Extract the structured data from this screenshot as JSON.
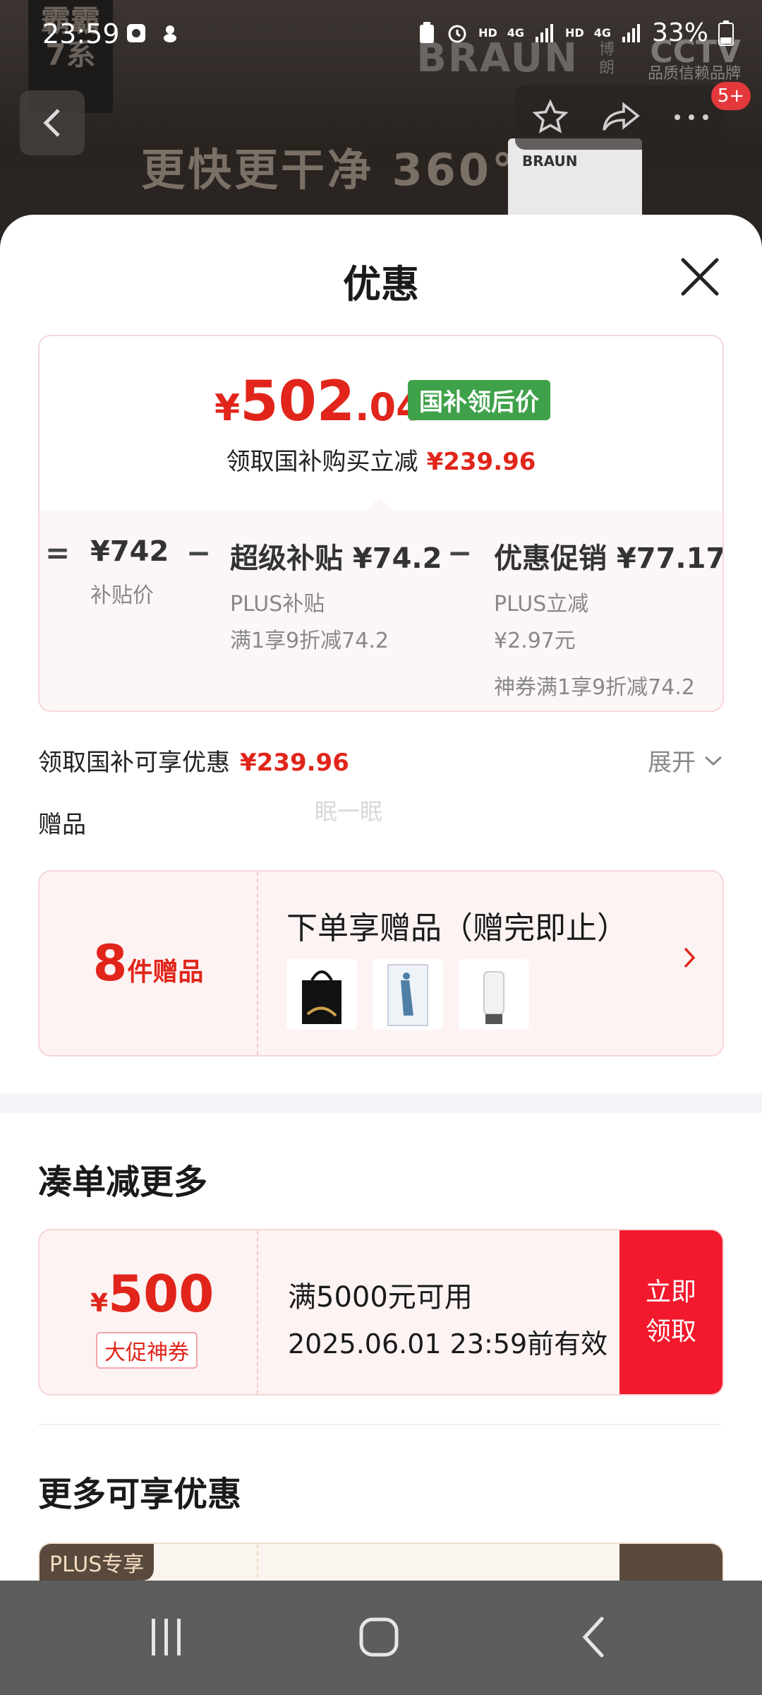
{
  "status_bar": {
    "time": "23:59",
    "battery": "33%",
    "network_a": "HD",
    "network_b": "4G",
    "network_c": "HD",
    "network_d": "4G"
  },
  "background_page": {
    "badge_text": "霸霸\n7系",
    "slogan": "更快更干净 360°贴",
    "brand": "BRAUN",
    "brand_cn": "博朗",
    "cctv": "CCTV",
    "cctv_sub": "品质信赖品牌",
    "box_label": "BRAUN",
    "count_badge": "5+"
  },
  "sheet": {
    "title": "优惠",
    "price": {
      "yen": "¥",
      "integer": "502",
      "decimal": ".04",
      "tag": "国补领后价",
      "save_text": "领取国补购买立减",
      "save_amount": "¥239.96"
    },
    "formula": {
      "eq": "=",
      "base_value": "¥742",
      "base_label": "补贴价",
      "minus1": "−",
      "super_subsidy": "超级补贴 ¥74.2",
      "super_sub1": "PLUS补贴",
      "super_sub2": "满1享9折减74.2",
      "minus2": "−",
      "promo": "优惠促销 ¥77.17",
      "promo_sub1": "PLUS立减",
      "promo_sub2": "¥2.97元",
      "promo_sub3": "神券满1享9折减74.2"
    },
    "gov_discount_label": "领取国补可享优惠",
    "gov_discount_amount": "¥239.96",
    "expand_label": "展开",
    "gifts_label": "赠品",
    "watermark": "眠一眠",
    "gift_card": {
      "count": "8",
      "count_unit": "件赠品",
      "title": "下单享赠品（赠完即止）"
    },
    "section_more": "凑单减更多",
    "coupon": {
      "yen": "¥",
      "amount": "500",
      "tag": "大促神券",
      "condition": "满5000元可用",
      "expiry": "2025.06.01 23:59前有效",
      "button_line1": "立即",
      "button_line2": "领取"
    },
    "section_extra": "更多可享优惠",
    "plus_tag": "PLUS专享"
  },
  "colors": {
    "accent_red": "#e1251b",
    "button_red": "#f2192c",
    "gov_green": "#3fa14a",
    "plus_brown": "#5a4a3e"
  }
}
